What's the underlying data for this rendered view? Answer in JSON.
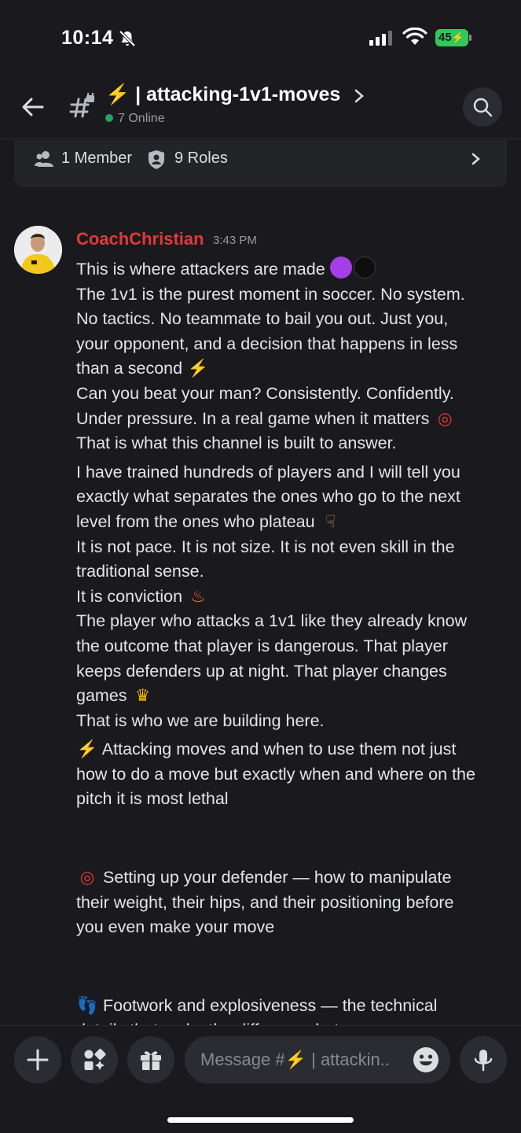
{
  "status_bar": {
    "time": "10:14",
    "battery": "45"
  },
  "header": {
    "channel_name": "⚡️ | attacking-1v1-moves",
    "online": "7 Online"
  },
  "member_card": {
    "members": "1 Member",
    "roles": "9 Roles"
  },
  "message": {
    "author": "CoachChristian",
    "author_color": "#e03a3a",
    "timestamp": "3:43 PM",
    "lines": {
      "l1": "This is where attackers are made",
      "l2": "The 1v1 is the purest moment in soccer. No system.",
      "l3": "No tactics. No teammate to bail you out. Just you,",
      "l4": "your opponent, and a decision that happens in less",
      "l5": "than a second",
      "l6": "Can you beat your man? Consistently. Confidently.",
      "l7": "Under pressure. In a real game when it matters",
      "l8": "That is what this channel is built to answer.",
      "l9": "I have trained hundreds of players and I will tell you",
      "l10": "exactly what separates the ones who go to the next",
      "l11": "level from the ones who plateau",
      "l12": "It is not pace. It is not size. It is not even skill in the",
      "l13": "traditional sense.",
      "l14": "It is conviction",
      "l15": "The player who attacks a 1v1 like they already know",
      "l16": "the outcome that player is dangerous. That player",
      "l17": "keeps defenders up at night. That player changes",
      "l18": "games",
      "l19": "That is who we are building here.",
      "l20": "Attacking moves and when to use them not just",
      "l21": "how to do a move but exactly when and where on the",
      "l22": "pitch it is most lethal",
      "l23": "Setting up your defender — how to manipulate",
      "l24": "their weight, their hips, and their positioning before",
      "l25": "you even make your move",
      "l26": "Footwork and explosiveness — the technical",
      "l27": "details that make the difference between a move"
    }
  },
  "composer": {
    "placeholder": "Message #⚡️ | attackin.."
  }
}
